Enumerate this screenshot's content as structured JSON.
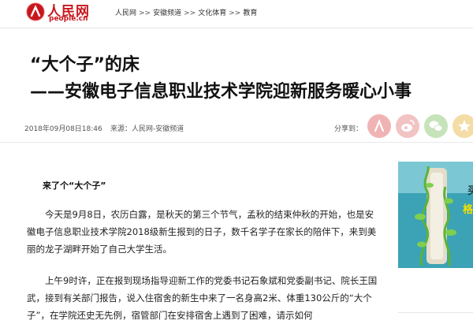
{
  "header": {
    "logo_text": "人民网",
    "logo_url": "people.cn",
    "breadcrumb": [
      "人民网",
      "安徽频道",
      "文化体育",
      "教育"
    ],
    "separator": ">>"
  },
  "article": {
    "title_line1": "“大个子”的床",
    "title_line2": "——安徽电子信息职业技术学院迎新服务暖心小事",
    "date": "2018年09月08日18:46",
    "source": "来源：人民网-安徽频道",
    "share_label": "分享到：",
    "subheading": "来了个“大个子”",
    "paragraphs": [
      "今天是9月8日，农历白露，是秋天的第三个节气，孟秋的结束仲秋的开始，也是安徽电子信息职业技术学院2018级新生报到的日子，数千名学子在家长的陪伴下，来到美丽的龙子湖畔开始了自己大学生活。",
      "上午9时许，正在报到现场指导迎新工作的党委书记石象斌和党委副书记、院长王国武，接到有关部门报告，说入住宿舍的新生中来了一名身高2米、体重130公斤的“大个子”，在学院还史无先例，宿管部门在安排宿舍上遇到了困难，请示如何"
    ]
  },
  "share_buttons": [
    {
      "name": "people",
      "color": "#f0b3b3"
    },
    {
      "name": "weibo",
      "color": "#f2c3c3"
    },
    {
      "name": "wechat",
      "color": "#c6e3b9"
    },
    {
      "name": "qzone",
      "color": "#f3dca6"
    }
  ],
  "ad": {
    "line1": "买",
    "line2": "格力"
  }
}
